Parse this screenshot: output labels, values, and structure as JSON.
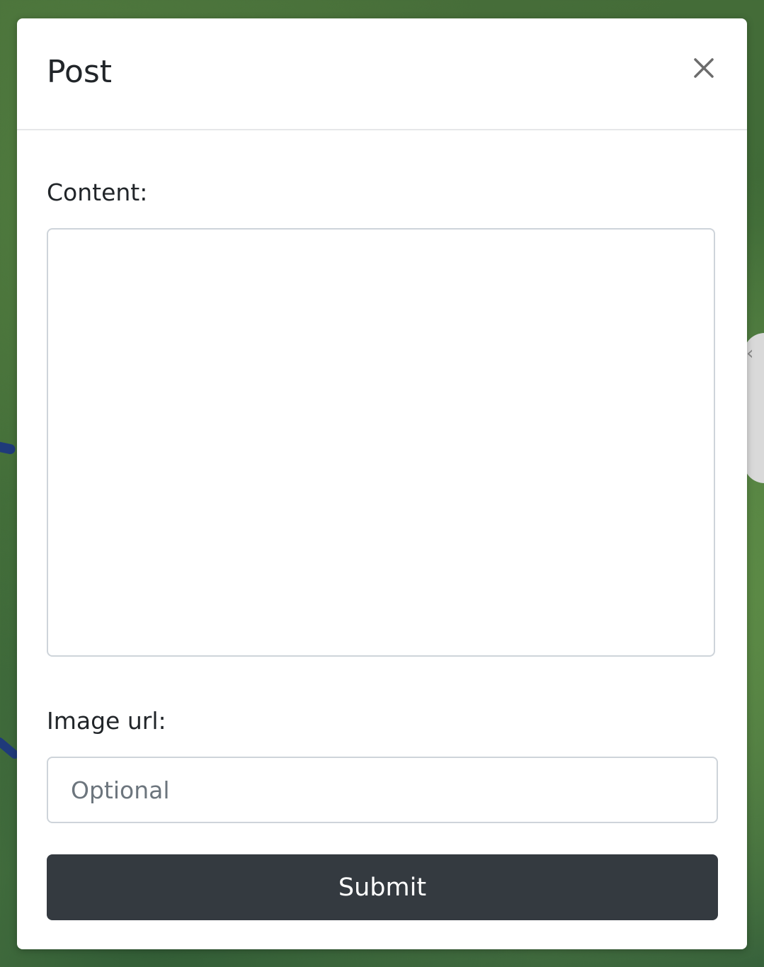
{
  "modal": {
    "title": "Post",
    "close_icon": "close-icon"
  },
  "form": {
    "content_label": "Content:",
    "content_value": "",
    "image_url_label": "Image url:",
    "image_url_value": "",
    "image_url_placeholder": "Optional",
    "submit_label": "Submit"
  },
  "colors": {
    "button_bg": "#343a40",
    "button_text": "#ffffff",
    "input_border": "#ced4da",
    "placeholder": "#6c757d"
  }
}
